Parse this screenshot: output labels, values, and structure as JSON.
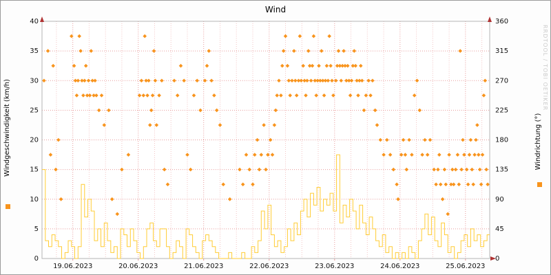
{
  "chart_data": {
    "type": "mixed",
    "title": "Wind",
    "watermark": "RRDTOOL / TOBI OETIKER",
    "left_axis": {
      "label": "Windgeschwindigkeit (km/h)",
      "min": 0,
      "max": 40,
      "ticks": [
        0,
        5,
        10,
        15,
        20,
        25,
        30,
        35,
        40
      ]
    },
    "right_axis": {
      "label": "Windrichtung (°)",
      "min": 0,
      "max": 360,
      "ticks": [
        0,
        45,
        90,
        135,
        180,
        225,
        270,
        315,
        360
      ]
    },
    "x_axis": {
      "min": 18.53,
      "max": 25.37,
      "minor_step": 0.25,
      "labels": [
        {
          "text": "19.06.2023",
          "x": 19
        },
        {
          "text": "20.06.2023",
          "x": 20
        },
        {
          "text": "21.06.2023",
          "x": 21
        },
        {
          "text": "22.06.2023",
          "x": 22
        },
        {
          "text": "23.06.2023",
          "x": 23
        },
        {
          "text": "24.06.2023",
          "x": 24
        },
        {
          "text": "25.06.2023",
          "x": 25
        }
      ]
    },
    "style": {
      "plot_background": "#ffffff",
      "frame": "#b5b5b5",
      "grid_major": "#e89b9b",
      "grid_minor": "#f3c3c3",
      "arrow": "#b03333"
    },
    "legend": {
      "left_swatch_color": "#f8941d",
      "right_swatch_color": "#f8941d"
    },
    "series": [
      {
        "name": "Windrichtung",
        "type": "scatter",
        "marker": "diamond",
        "axis": "right",
        "color": "#f8941d",
        "points": [
          [
            18.56,
            270
          ],
          [
            18.62,
            315
          ],
          [
            18.66,
            157.5
          ],
          [
            18.7,
            292.5
          ],
          [
            18.74,
            135
          ],
          [
            18.78,
            180
          ],
          [
            18.82,
            90
          ],
          [
            18.98,
            337.5
          ],
          [
            19.02,
            292.5
          ],
          [
            19.04,
            270
          ],
          [
            19.06,
            247.5
          ],
          [
            19.08,
            270
          ],
          [
            19.1,
            337.5
          ],
          [
            19.12,
            315
          ],
          [
            19.14,
            270
          ],
          [
            19.16,
            247.5
          ],
          [
            19.18,
            270
          ],
          [
            19.2,
            292.5
          ],
          [
            19.22,
            247.5
          ],
          [
            19.24,
            270
          ],
          [
            19.26,
            247.5
          ],
          [
            19.28,
            315
          ],
          [
            19.3,
            270
          ],
          [
            19.32,
            247.5
          ],
          [
            19.34,
            270
          ],
          [
            19.36,
            247.5
          ],
          [
            19.4,
            225
          ],
          [
            19.44,
            247.5
          ],
          [
            19.48,
            202.5
          ],
          [
            19.55,
            225
          ],
          [
            19.6,
            90
          ],
          [
            19.68,
            67.5
          ],
          [
            19.75,
            135
          ],
          [
            19.85,
            157.5
          ],
          [
            20.02,
            247.5
          ],
          [
            20.05,
            270
          ],
          [
            20.08,
            247.5
          ],
          [
            20.1,
            337.5
          ],
          [
            20.12,
            270
          ],
          [
            20.14,
            247.5
          ],
          [
            20.16,
            270
          ],
          [
            20.18,
            202.5
          ],
          [
            20.2,
            225
          ],
          [
            20.22,
            247.5
          ],
          [
            20.24,
            315
          ],
          [
            20.26,
            270
          ],
          [
            20.28,
            202.5
          ],
          [
            20.32,
            247.5
          ],
          [
            20.36,
            270
          ],
          [
            20.4,
            135
          ],
          [
            20.45,
            112.5
          ],
          [
            20.55,
            270
          ],
          [
            20.6,
            247.5
          ],
          [
            20.65,
            292.5
          ],
          [
            20.7,
            270
          ],
          [
            20.75,
            157.5
          ],
          [
            20.8,
            135
          ],
          [
            20.85,
            247.5
          ],
          [
            20.9,
            270
          ],
          [
            20.95,
            225
          ],
          [
            21.02,
            270
          ],
          [
            21.05,
            292.5
          ],
          [
            21.08,
            315
          ],
          [
            21.12,
            270
          ],
          [
            21.16,
            247.5
          ],
          [
            21.2,
            225
          ],
          [
            21.25,
            202.5
          ],
          [
            21.3,
            112.5
          ],
          [
            21.4,
            90
          ],
          [
            21.55,
            135
          ],
          [
            21.6,
            112.5
          ],
          [
            21.65,
            157.5
          ],
          [
            21.7,
            135
          ],
          [
            21.75,
            112.5
          ],
          [
            21.78,
            157.5
          ],
          [
            21.82,
            180
          ],
          [
            21.85,
            135
          ],
          [
            21.88,
            157.5
          ],
          [
            21.92,
            202.5
          ],
          [
            21.95,
            135
          ],
          [
            21.98,
            157.5
          ],
          [
            22.02,
            180
          ],
          [
            22.05,
            157.5
          ],
          [
            22.08,
            202.5
          ],
          [
            22.1,
            225
          ],
          [
            22.12,
            247.5
          ],
          [
            22.15,
            270
          ],
          [
            22.18,
            247.5
          ],
          [
            22.2,
            292.5
          ],
          [
            22.22,
            315
          ],
          [
            22.25,
            337.5
          ],
          [
            22.28,
            292.5
          ],
          [
            22.3,
            270
          ],
          [
            22.32,
            247.5
          ],
          [
            22.35,
            270
          ],
          [
            22.38,
            315
          ],
          [
            22.4,
            270
          ],
          [
            22.42,
            247.5
          ],
          [
            22.45,
            270
          ],
          [
            22.47,
            337.5
          ],
          [
            22.49,
            270
          ],
          [
            22.52,
            292.5
          ],
          [
            22.54,
            270
          ],
          [
            22.56,
            247.5
          ],
          [
            22.58,
            270
          ],
          [
            22.6,
            315
          ],
          [
            22.62,
            292.5
          ],
          [
            22.64,
            270
          ],
          [
            22.66,
            292.5
          ],
          [
            22.68,
            337.5
          ],
          [
            22.7,
            270
          ],
          [
            22.72,
            247.5
          ],
          [
            22.74,
            270
          ],
          [
            22.76,
            292.5
          ],
          [
            22.78,
            270
          ],
          [
            22.8,
            315
          ],
          [
            22.82,
            270
          ],
          [
            22.84,
            247.5
          ],
          [
            22.86,
            270
          ],
          [
            22.88,
            292.5
          ],
          [
            22.9,
            270
          ],
          [
            22.92,
            337.5
          ],
          [
            22.94,
            292.5
          ],
          [
            22.96,
            270
          ],
          [
            22.98,
            247.5
          ],
          [
            23.02,
            270
          ],
          [
            23.04,
            292.5
          ],
          [
            23.06,
            315
          ],
          [
            23.08,
            292.5
          ],
          [
            23.1,
            270
          ],
          [
            23.12,
            292.5
          ],
          [
            23.14,
            315
          ],
          [
            23.16,
            292.5
          ],
          [
            23.18,
            270
          ],
          [
            23.2,
            292.5
          ],
          [
            23.22,
            270
          ],
          [
            23.24,
            247.5
          ],
          [
            23.26,
            270
          ],
          [
            23.28,
            292.5
          ],
          [
            23.3,
            315
          ],
          [
            23.32,
            292.5
          ],
          [
            23.34,
            270
          ],
          [
            23.36,
            247.5
          ],
          [
            23.38,
            270
          ],
          [
            23.4,
            292.5
          ],
          [
            23.42,
            270
          ],
          [
            23.45,
            225
          ],
          [
            23.48,
            247.5
          ],
          [
            23.52,
            270
          ],
          [
            23.55,
            247.5
          ],
          [
            23.58,
            270
          ],
          [
            23.62,
            225
          ],
          [
            23.65,
            202.5
          ],
          [
            23.7,
            180
          ],
          [
            23.75,
            157.5
          ],
          [
            23.8,
            180
          ],
          [
            23.85,
            157.5
          ],
          [
            23.9,
            135
          ],
          [
            23.95,
            112.5
          ],
          [
            23.97,
            90
          ],
          [
            24.02,
            157.5
          ],
          [
            24.05,
            180
          ],
          [
            24.08,
            157.5
          ],
          [
            24.1,
            135
          ],
          [
            24.14,
            180
          ],
          [
            24.18,
            157.5
          ],
          [
            24.22,
            247.5
          ],
          [
            24.26,
            270
          ],
          [
            24.3,
            225
          ],
          [
            24.34,
            157.5
          ],
          [
            24.38,
            180
          ],
          [
            24.42,
            157.5
          ],
          [
            24.46,
            180
          ],
          [
            24.52,
            135
          ],
          [
            24.55,
            112.5
          ],
          [
            24.58,
            135
          ],
          [
            24.6,
            157.5
          ],
          [
            24.62,
            112.5
          ],
          [
            24.65,
            90
          ],
          [
            24.68,
            135
          ],
          [
            24.7,
            112.5
          ],
          [
            24.73,
            67.5
          ],
          [
            24.75,
            157.5
          ],
          [
            24.78,
            112.5
          ],
          [
            24.8,
            135
          ],
          [
            24.82,
            112.5
          ],
          [
            24.85,
            135
          ],
          [
            24.88,
            157.5
          ],
          [
            24.9,
            112.5
          ],
          [
            24.92,
            315
          ],
          [
            24.94,
            135
          ],
          [
            24.96,
            180
          ],
          [
            24.98,
            157.5
          ],
          [
            25.02,
            135
          ],
          [
            25.04,
            112.5
          ],
          [
            25.06,
            157.5
          ],
          [
            25.08,
            180
          ],
          [
            25.1,
            135
          ],
          [
            25.12,
            112.5
          ],
          [
            25.14,
            157.5
          ],
          [
            25.16,
            180
          ],
          [
            25.18,
            202.5
          ],
          [
            25.2,
            157.5
          ],
          [
            25.22,
            135
          ],
          [
            25.24,
            112.5
          ],
          [
            25.26,
            157.5
          ],
          [
            25.28,
            247.5
          ],
          [
            25.3,
            270
          ],
          [
            25.32,
            135
          ],
          [
            25.34,
            112.5
          ]
        ]
      },
      {
        "name": "Windgeschwindigkeit",
        "type": "step-line",
        "axis": "left",
        "color": "#ffcc33",
        "x_start": 18.53,
        "x_step": 0.05,
        "values": [
          15,
          3,
          2,
          4,
          3,
          2,
          0,
          1,
          3,
          2,
          0,
          2,
          12.5,
          7,
          10,
          8,
          3,
          5,
          2,
          6,
          3,
          1,
          2,
          0,
          5,
          4,
          2,
          5,
          3,
          1,
          0,
          2,
          5,
          6,
          3,
          2,
          5,
          5,
          2,
          0,
          1,
          3,
          2,
          0,
          5,
          4,
          2,
          1,
          0,
          3,
          4,
          3,
          2,
          1,
          0,
          0,
          0,
          1,
          0,
          0,
          0,
          1,
          0,
          0,
          2,
          1,
          3,
          8,
          5,
          9,
          4,
          2,
          3,
          1,
          2,
          5,
          3,
          6,
          4,
          8,
          10,
          7,
          11,
          9,
          12,
          8,
          10,
          9,
          11,
          8,
          17.5,
          6,
          9,
          7,
          10,
          8,
          5,
          9,
          6,
          4,
          7,
          5,
          3,
          2,
          4,
          1,
          2,
          0,
          1,
          0,
          1,
          0,
          2,
          1,
          0,
          3,
          5,
          7.5,
          4,
          7,
          3,
          2,
          6,
          4,
          1,
          2,
          0,
          1,
          3,
          4,
          2,
          5,
          3,
          4,
          2,
          3,
          4
        ]
      }
    ]
  }
}
